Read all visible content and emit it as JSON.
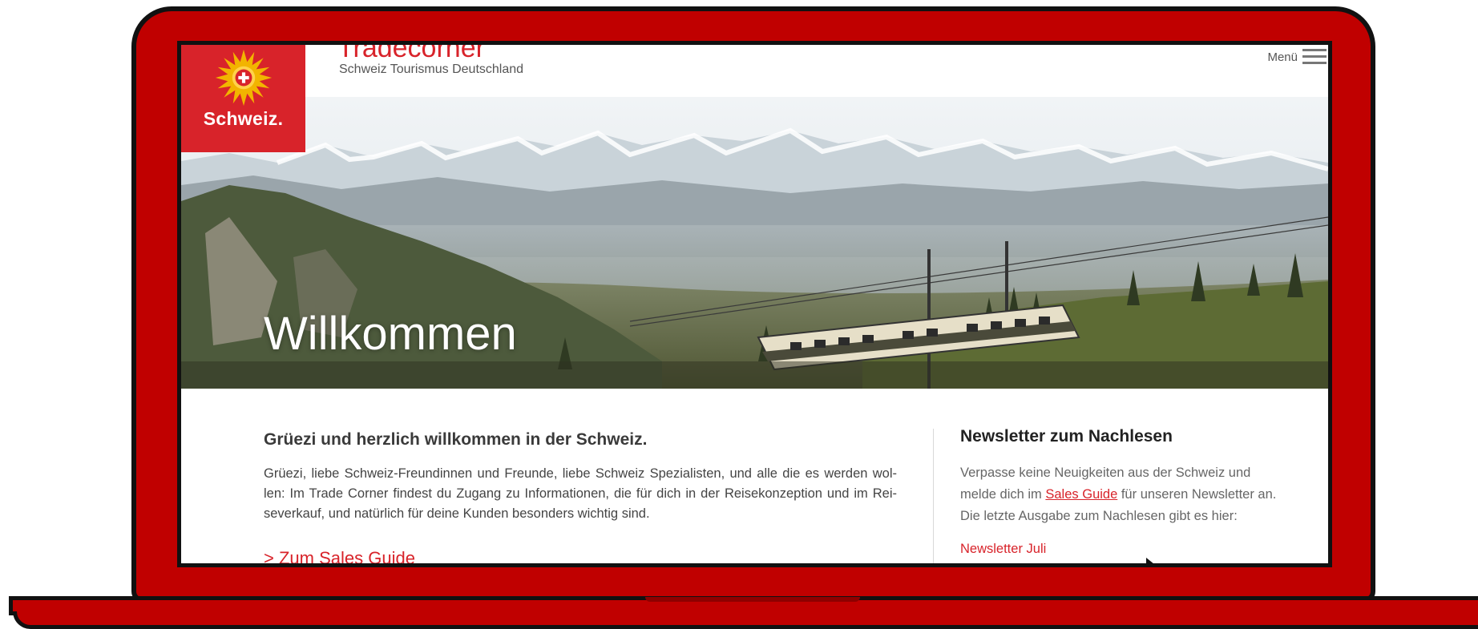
{
  "header": {
    "title": "Tradecorner",
    "subtitle": "Schweiz Tourismus Deutschland",
    "menu_label": "Menü"
  },
  "logo": {
    "text": "Schweiz.",
    "icon": "swiss-flower-icon"
  },
  "hero": {
    "title": "Willkommen"
  },
  "main": {
    "heading": "Grüezi und herzlich willkommen in der Schweiz.",
    "text": "Grüezi, liebe Schweiz-Freundinnen und Freunde, liebe Schweiz Spezialisten, und alle die es werden wol-len: Im Trade Corner findest du Zugang zu Informationen, die für dich in der Reisekonzeption und im Rei-severkauf, und natürlich für deine Kunden besonders wichtig sind.",
    "link": "> Zum Sales Guide"
  },
  "sidebar": {
    "heading": "Newsletter zum Nachlesen",
    "text_before": "Verpasse keine Neuigkeiten aus der Schweiz und melde dich im ",
    "inline_link": "Sales Guide",
    "text_after": " für unseren Newsletter an. Die letzte Ausgabe zum Nachlesen gibt es hier:",
    "newsletter_link": "Newsletter Juli"
  },
  "colors": {
    "brand_red": "#d8232a",
    "laptop_red": "#c00000",
    "frame_black": "#111111"
  }
}
